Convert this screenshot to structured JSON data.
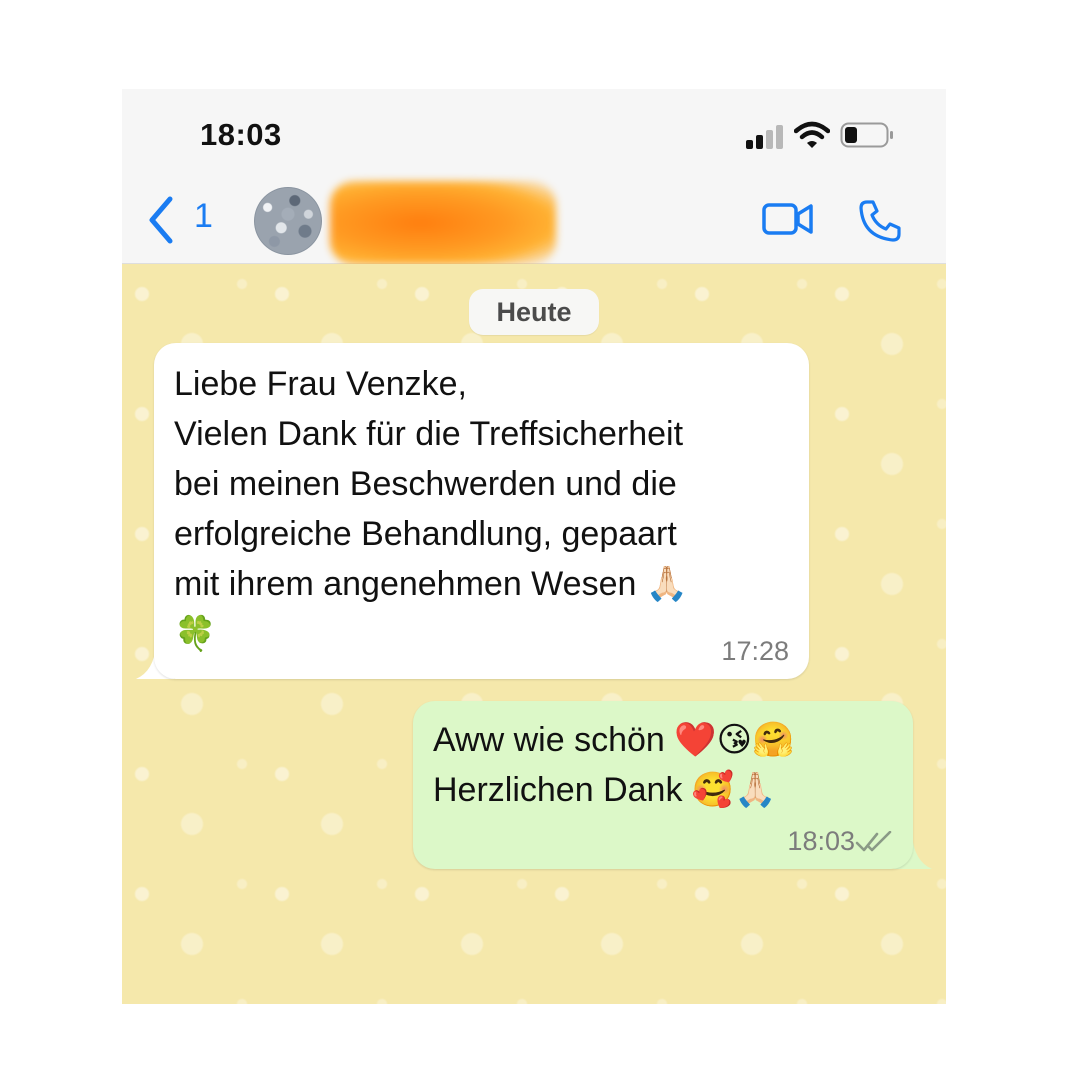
{
  "status_bar": {
    "time": "18:03"
  },
  "header": {
    "unread_count": "1",
    "contact_name": ""
  },
  "chat": {
    "date_chip": "Heute",
    "messages": [
      {
        "direction": "incoming",
        "lines": [
          "Liebe Frau Venzke,",
          "Vielen Dank für die Treffsicherheit",
          "bei meinen Beschwerden und die",
          "erfolgreiche Behandlung, gepaart",
          "mit ihrem angenehmen Wesen 🙏🏻",
          "🍀"
        ],
        "time": "17:28"
      },
      {
        "direction": "outgoing",
        "lines": [
          "Aww wie schön ❤️😘🤗",
          "Herzlichen Dank 🥰🙏🏻"
        ],
        "time": "18:03",
        "status_icon": "double-check-icon"
      }
    ]
  },
  "colors": {
    "accent": "#1a7cf2",
    "chat_background": "#f5e8ab",
    "incoming_bubble": "#ffffff",
    "outgoing_bubble": "#dcf8c8",
    "redaction": "#ff8a1a"
  }
}
